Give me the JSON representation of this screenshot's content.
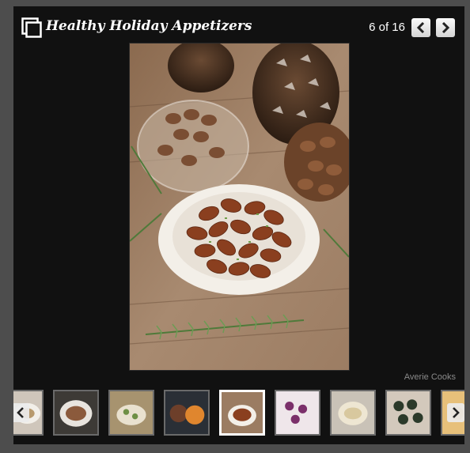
{
  "gallery": {
    "title": "Healthy Holiday Appetizers",
    "counter": "6 of 16",
    "credit": "Averie Cooks"
  },
  "icons": {
    "gallery": "gallery-stack-icon",
    "prev": "chevron-left-icon",
    "next": "chevron-right-icon"
  },
  "main_image": {
    "alt": "Roasted almonds in a white bowl with rosemary sprigs and pine cones"
  },
  "thumbnails": [
    {
      "subject": "partial thumbnail"
    },
    {
      "subject": "roasted chicken dish"
    },
    {
      "subject": "pastry appetizer"
    },
    {
      "subject": "dip bowls"
    },
    {
      "subject": "roasted almonds",
      "active": true
    },
    {
      "subject": "purple appetizer bites"
    },
    {
      "subject": "cheese dip"
    },
    {
      "subject": "sushi rolls"
    },
    {
      "subject": "partial thumbnail"
    }
  ],
  "colors": {
    "background": "#4d4d4d",
    "panel": "#111111",
    "title_text": "#ffffff",
    "credit_text": "#8a8a8a"
  }
}
